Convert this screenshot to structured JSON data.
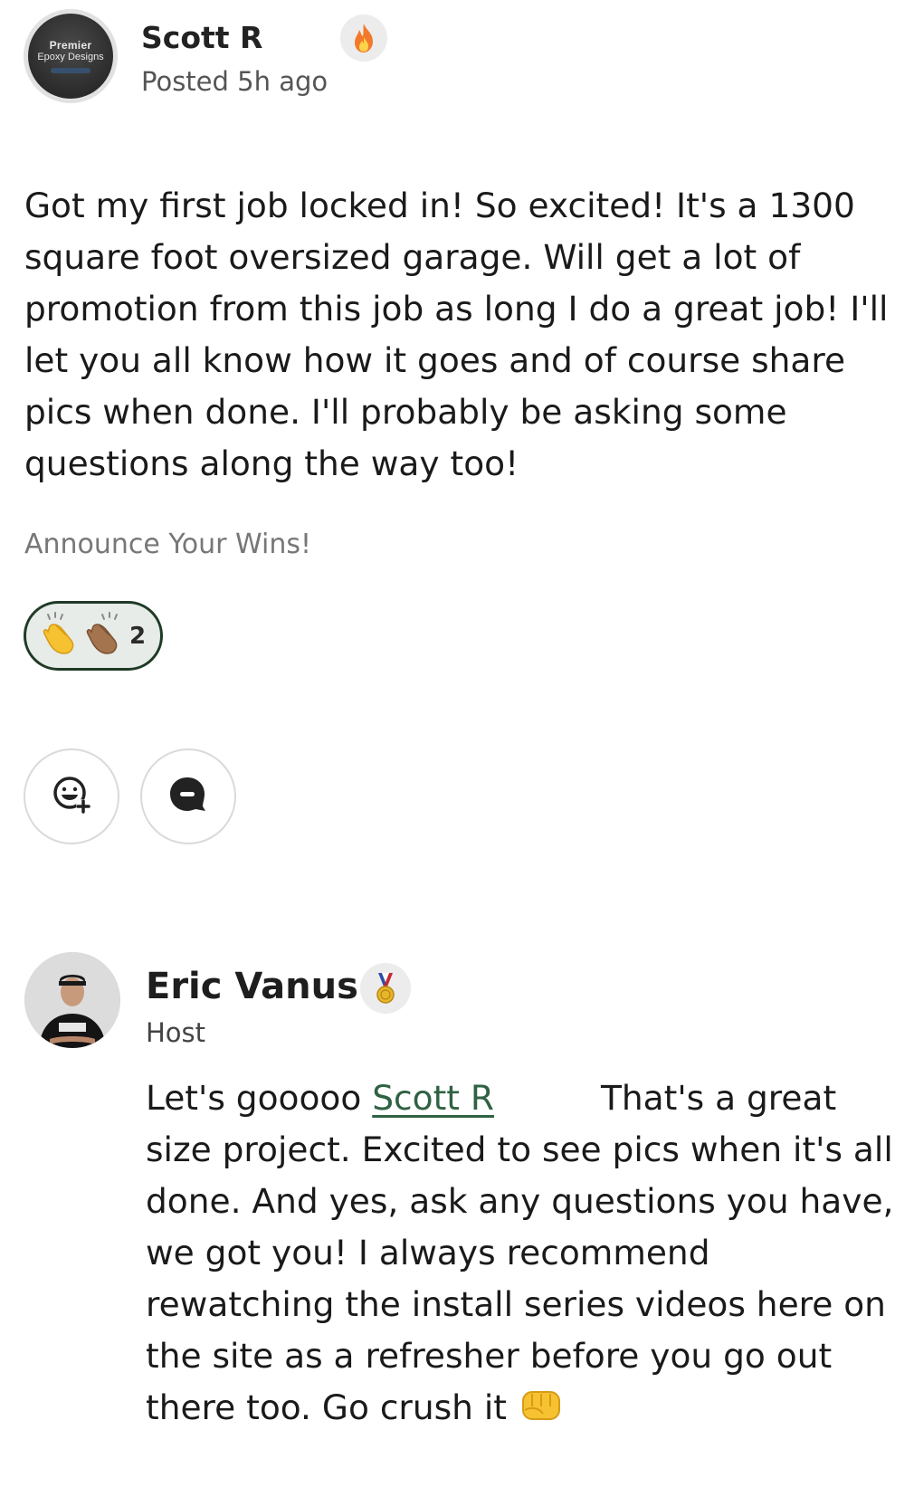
{
  "post": {
    "author": "Scott R",
    "avatar_text_line1": "Premier",
    "avatar_text_line2": "Epoxy Designs",
    "badge_icon": "fire-icon",
    "posted": "Posted 5h ago",
    "body": "Got my first job locked in! So excited! It's a 1300 square foot oversized garage. Will get a lot of promotion from this job as long I do a great job! I'll let you all know how it goes and of course share pics when done. I'll probably be asking some questions along the way too!",
    "category": "Announce Your Wins!",
    "reactions": {
      "icons": [
        "clapping-hands-icon",
        "clapping-hands-medium-dark-icon"
      ],
      "count": "2"
    },
    "actions": [
      "add-reaction-icon",
      "comment-icon"
    ]
  },
  "comment": {
    "author": "Eric Vanus",
    "badge_icon": "medal-icon",
    "role": "Host",
    "body_prefix": "Let's gooooo ",
    "mention": "Scott R",
    "body_rest": "That's a great size project. Excited to see pics when it's all done. And yes, ask any questions you have, we got you! I always recommend rewatching the install series videos here on the site as a refresher before you go out there too. Go crush it ",
    "trailing_icon": "fist-bump-icon"
  },
  "colors": {
    "accent_green": "#2f6243",
    "pill_border": "#1f3a26",
    "pill_bg": "#e7ece8"
  }
}
